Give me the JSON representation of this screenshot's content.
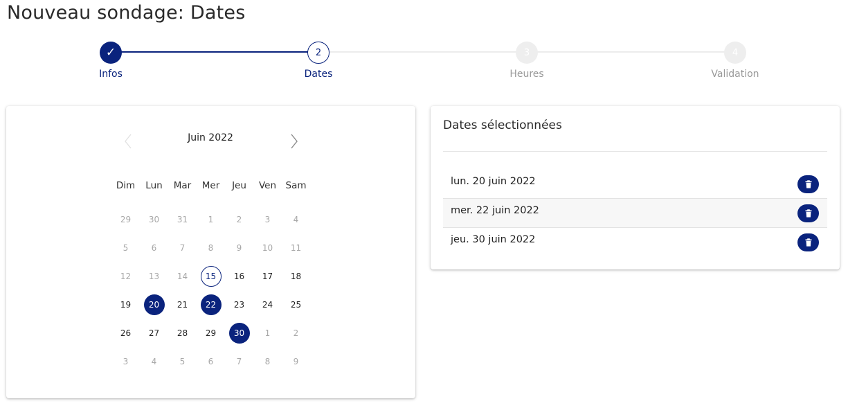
{
  "page": {
    "title": "Nouveau sondage: Dates"
  },
  "stepper": {
    "steps": [
      {
        "number": "✓",
        "label": "Infos",
        "state": "done"
      },
      {
        "number": "2",
        "label": "Dates",
        "state": "active"
      },
      {
        "number": "3",
        "label": "Heures",
        "state": "todo"
      },
      {
        "number": "4",
        "label": "Validation",
        "state": "todo"
      }
    ],
    "accent_color": "#0a237d"
  },
  "calendar": {
    "month_label": "Juin 2022",
    "weekdays": [
      "Dim",
      "Lun",
      "Mar",
      "Mer",
      "Jeu",
      "Ven",
      "Sam"
    ],
    "weeks": [
      [
        {
          "d": "29",
          "s": "out"
        },
        {
          "d": "30",
          "s": "out"
        },
        {
          "d": "31",
          "s": "out"
        },
        {
          "d": "1",
          "s": "past"
        },
        {
          "d": "2",
          "s": "past"
        },
        {
          "d": "3",
          "s": "past"
        },
        {
          "d": "4",
          "s": "past"
        }
      ],
      [
        {
          "d": "5",
          "s": "past"
        },
        {
          "d": "6",
          "s": "past"
        },
        {
          "d": "7",
          "s": "past"
        },
        {
          "d": "8",
          "s": "past"
        },
        {
          "d": "9",
          "s": "past"
        },
        {
          "d": "10",
          "s": "past"
        },
        {
          "d": "11",
          "s": "past"
        }
      ],
      [
        {
          "d": "12",
          "s": "past"
        },
        {
          "d": "13",
          "s": "past"
        },
        {
          "d": "14",
          "s": "past"
        },
        {
          "d": "15",
          "s": "today"
        },
        {
          "d": "16",
          "s": "day"
        },
        {
          "d": "17",
          "s": "day"
        },
        {
          "d": "18",
          "s": "day"
        }
      ],
      [
        {
          "d": "19",
          "s": "day"
        },
        {
          "d": "20",
          "s": "sel"
        },
        {
          "d": "21",
          "s": "day"
        },
        {
          "d": "22",
          "s": "sel"
        },
        {
          "d": "23",
          "s": "day"
        },
        {
          "d": "24",
          "s": "day"
        },
        {
          "d": "25",
          "s": "day"
        }
      ],
      [
        {
          "d": "26",
          "s": "day"
        },
        {
          "d": "27",
          "s": "day"
        },
        {
          "d": "28",
          "s": "day"
        },
        {
          "d": "29",
          "s": "day"
        },
        {
          "d": "30",
          "s": "sel"
        },
        {
          "d": "1",
          "s": "out"
        },
        {
          "d": "2",
          "s": "out"
        }
      ],
      [
        {
          "d": "3",
          "s": "out"
        },
        {
          "d": "4",
          "s": "out"
        },
        {
          "d": "5",
          "s": "out"
        },
        {
          "d": "6",
          "s": "out"
        },
        {
          "d": "7",
          "s": "out"
        },
        {
          "d": "8",
          "s": "out"
        },
        {
          "d": "9",
          "s": "out"
        }
      ]
    ]
  },
  "selected_dates": {
    "title": "Dates sélectionnées",
    "items": [
      {
        "label": "lun. 20 juin 2022",
        "delete_icon": "trash-icon"
      },
      {
        "label": "mer. 22 juin 2022",
        "delete_icon": "trash-icon"
      },
      {
        "label": "jeu. 30 juin 2022",
        "delete_icon": "trash-icon"
      }
    ]
  }
}
